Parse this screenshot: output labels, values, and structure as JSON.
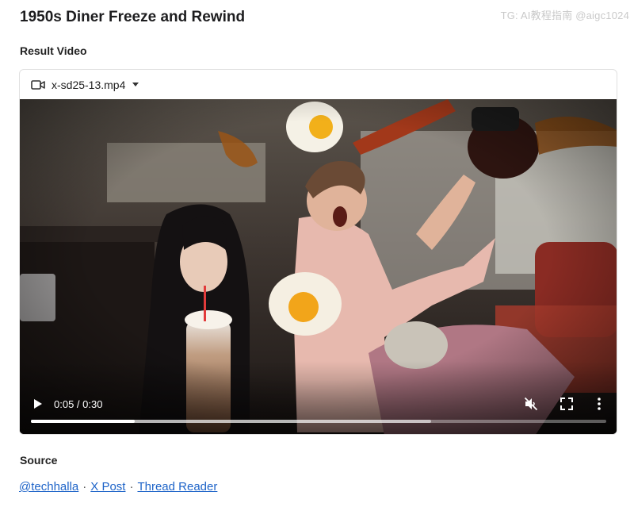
{
  "watermark": "TG: AI教程指南 @aigc1024",
  "page_title": "1950s Diner Freeze and Rewind",
  "result_heading": "Result Video",
  "video": {
    "file_name": "x-sd25-13.mp4",
    "time_display": "0:05 / 0:30",
    "played_fraction": 0.18,
    "buffered_fraction": 0.695,
    "muted": true
  },
  "source_heading": "Source",
  "links": [
    {
      "label": "@techhalla"
    },
    {
      "label": "X Post"
    },
    {
      "label": "Thread Reader"
    }
  ],
  "link_separator": "·",
  "icons": {
    "file": "video-camera-icon",
    "dropdown": "chevron-down-icon",
    "play": "play-icon",
    "mute": "volume-off-icon",
    "fullscreen": "fullscreen-icon",
    "more": "more-vert-icon"
  },
  "colors": {
    "link": "#1d63c8",
    "title": "#1d1d1f",
    "border": "#e1e1e1"
  }
}
